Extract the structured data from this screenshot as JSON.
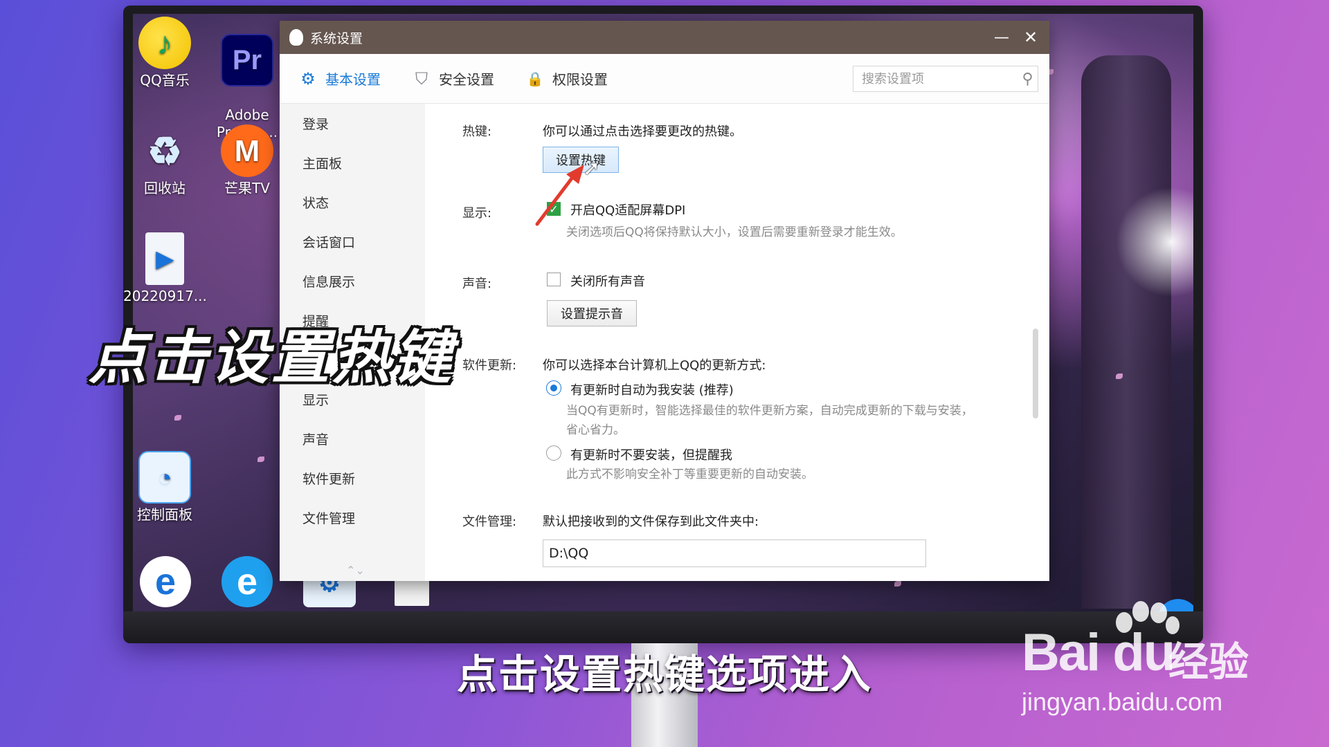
{
  "desktop": {
    "icons": [
      {
        "label": "QQ音乐",
        "glyph": "♪"
      },
      {
        "label": "Adobe\nPremie...",
        "glyph": "Pr"
      },
      {
        "label": "回收站",
        "glyph": "♻"
      },
      {
        "label": "芒果TV",
        "glyph": "M"
      },
      {
        "label": "20220917...",
        "glyph": "▶"
      },
      {
        "label": "控制面板",
        "glyph": "◔"
      }
    ]
  },
  "window": {
    "title": "系统设置",
    "minimize_glyph": "—",
    "close_glyph": "✕",
    "tabs": [
      {
        "label": "基本设置",
        "icon": "gear-icon",
        "glyph": "⚙"
      },
      {
        "label": "安全设置",
        "icon": "shield-icon",
        "glyph": "⛉"
      },
      {
        "label": "权限设置",
        "icon": "lock-icon",
        "glyph": "🔒"
      }
    ],
    "search": {
      "placeholder": "搜索设置项",
      "glyph": "⚲"
    },
    "sidebar": {
      "items": [
        "登录",
        "主面板",
        "状态",
        "会话窗口",
        "信息展示",
        "提醒",
        "",
        "显示",
        "声音",
        "软件更新",
        "文件管理"
      ],
      "arrows": "⌃⌄"
    },
    "settings": {
      "hotkey": {
        "label": "热键:",
        "desc": "你可以通过点击选择要更改的热键。",
        "button": "设置热键"
      },
      "display": {
        "label": "显示:",
        "checkbox_label": "开启QQ适配屏幕DPI",
        "checked": true,
        "note": "关闭选项后QQ将保持默认大小，设置后需要重新登录才能生效。"
      },
      "sound": {
        "label": "声音:",
        "checkbox_label": "关闭所有声音",
        "checked": false,
        "button": "设置提示音"
      },
      "update": {
        "label": "软件更新:",
        "desc": "你可以选择本台计算机上QQ的更新方式:",
        "options": [
          {
            "label": "有更新时自动为我安装 (推荐)",
            "note": "当QQ有更新时，智能选择最佳的软件更新方案，自动完成更新的下载与安装，省心省力。",
            "selected": true
          },
          {
            "label": "有更新时不要安装，但提醒我",
            "note": "此方式不影响安全补丁等重要更新的自动安装。",
            "selected": false
          }
        ]
      },
      "files": {
        "label": "文件管理:",
        "desc": "默认把接收到的文件保存到此文件夹中:",
        "path": "D:\\QQ"
      }
    }
  },
  "overlay": {
    "headline": "点击设置热键",
    "caption": "点击设置热键选项进入"
  },
  "watermark": {
    "brand": "Bai du",
    "brand_cn": "经验",
    "url": "jingyan.baidu.com"
  },
  "colors": {
    "accent": "#1a7ad9",
    "titlebar": "#65564f",
    "checkbox_on": "#2ea043",
    "annotation_arrow": "#e23b2e"
  }
}
